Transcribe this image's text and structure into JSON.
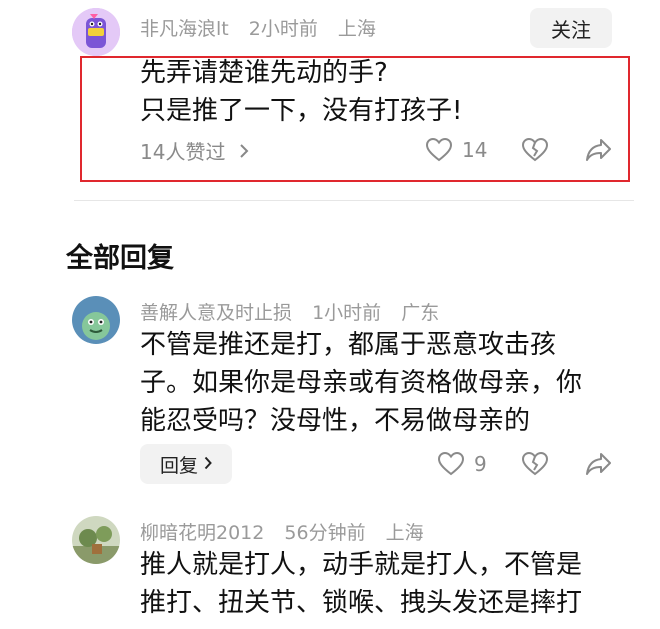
{
  "top_comment": {
    "username": "非凡海浪lt",
    "time": "2小时前",
    "location": "上海",
    "follow_label": "关注",
    "text_lines": [
      "先弄请楚谁先动的手?",
      "只是推了一下，没有打孩子!"
    ],
    "likes_text": "14人赞过",
    "like_count": "14"
  },
  "section_title": "全部回复",
  "replies": [
    {
      "username": "善解人意及时止损",
      "time": "1小时前",
      "location": "广东",
      "text_lines": [
        "不管是推还是打，都属于恶意攻击孩",
        "子。如果你是母亲或有资格做母亲，你",
        "能忍受吗？没母性，不易做母亲的"
      ],
      "reply_label": "回复",
      "like_count": "9"
    },
    {
      "username": "柳暗花明2012",
      "time": "56分钟前",
      "location": "上海",
      "text_lines": [
        "推人就是打人，动手就是打人，不管是",
        "推打、扭关节、锁喉、拽头发还是摔打"
      ]
    }
  ],
  "icons": {
    "chevron": "chevron-right-icon",
    "like": "heart-icon",
    "dislike": "broken-heart-icon",
    "share": "share-icon"
  },
  "colors": {
    "highlight_border": "#e0282e",
    "meta_text": "#9a9a9a"
  }
}
